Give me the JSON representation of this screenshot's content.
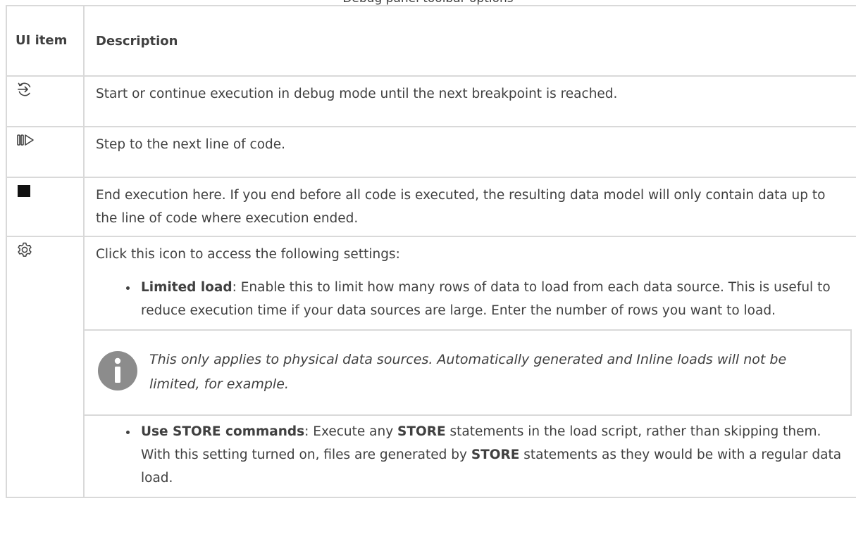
{
  "caption": "Debug panel toolbar options",
  "table": {
    "header": {
      "col1": "UI item",
      "col2": "Description"
    },
    "rows": [
      {
        "icon": "run-debug-icon",
        "description": "Start or continue execution in debug mode until the next breakpoint is reached."
      },
      {
        "icon": "step-icon",
        "description": "Step to the next line of code."
      },
      {
        "icon": "stop-square-icon",
        "description": "End execution here. If you end before all code is executed, the resulting data model will only contain data up to the line of code where execution ended."
      },
      {
        "icon": "gear-icon",
        "description": "Click this icon to access the following settings:",
        "bullets": [
          {
            "term": "Limited load",
            "text": ": Enable this to limit how many rows of data to load from each data source. This is useful to reduce execution time if your data sources are large. Enter the number of rows you want to load."
          },
          {
            "term": "Use STORE commands",
            "text_1": ": Execute any ",
            "bold_1": "STORE",
            "text_2": " statements in the load script, rather than skipping them. With this setting turned on, files are generated by ",
            "bold_2": "STORE",
            "text_3": " statements as they would be with a regular data load."
          }
        ],
        "note": {
          "icon": "info-icon",
          "text": "This only applies to physical data sources. Automatically generated and Inline loads will not be limited, for example."
        }
      }
    ]
  },
  "colors": {
    "text": "#404040",
    "border": "#d9d9d9",
    "info_icon": "#8c8c8c"
  }
}
